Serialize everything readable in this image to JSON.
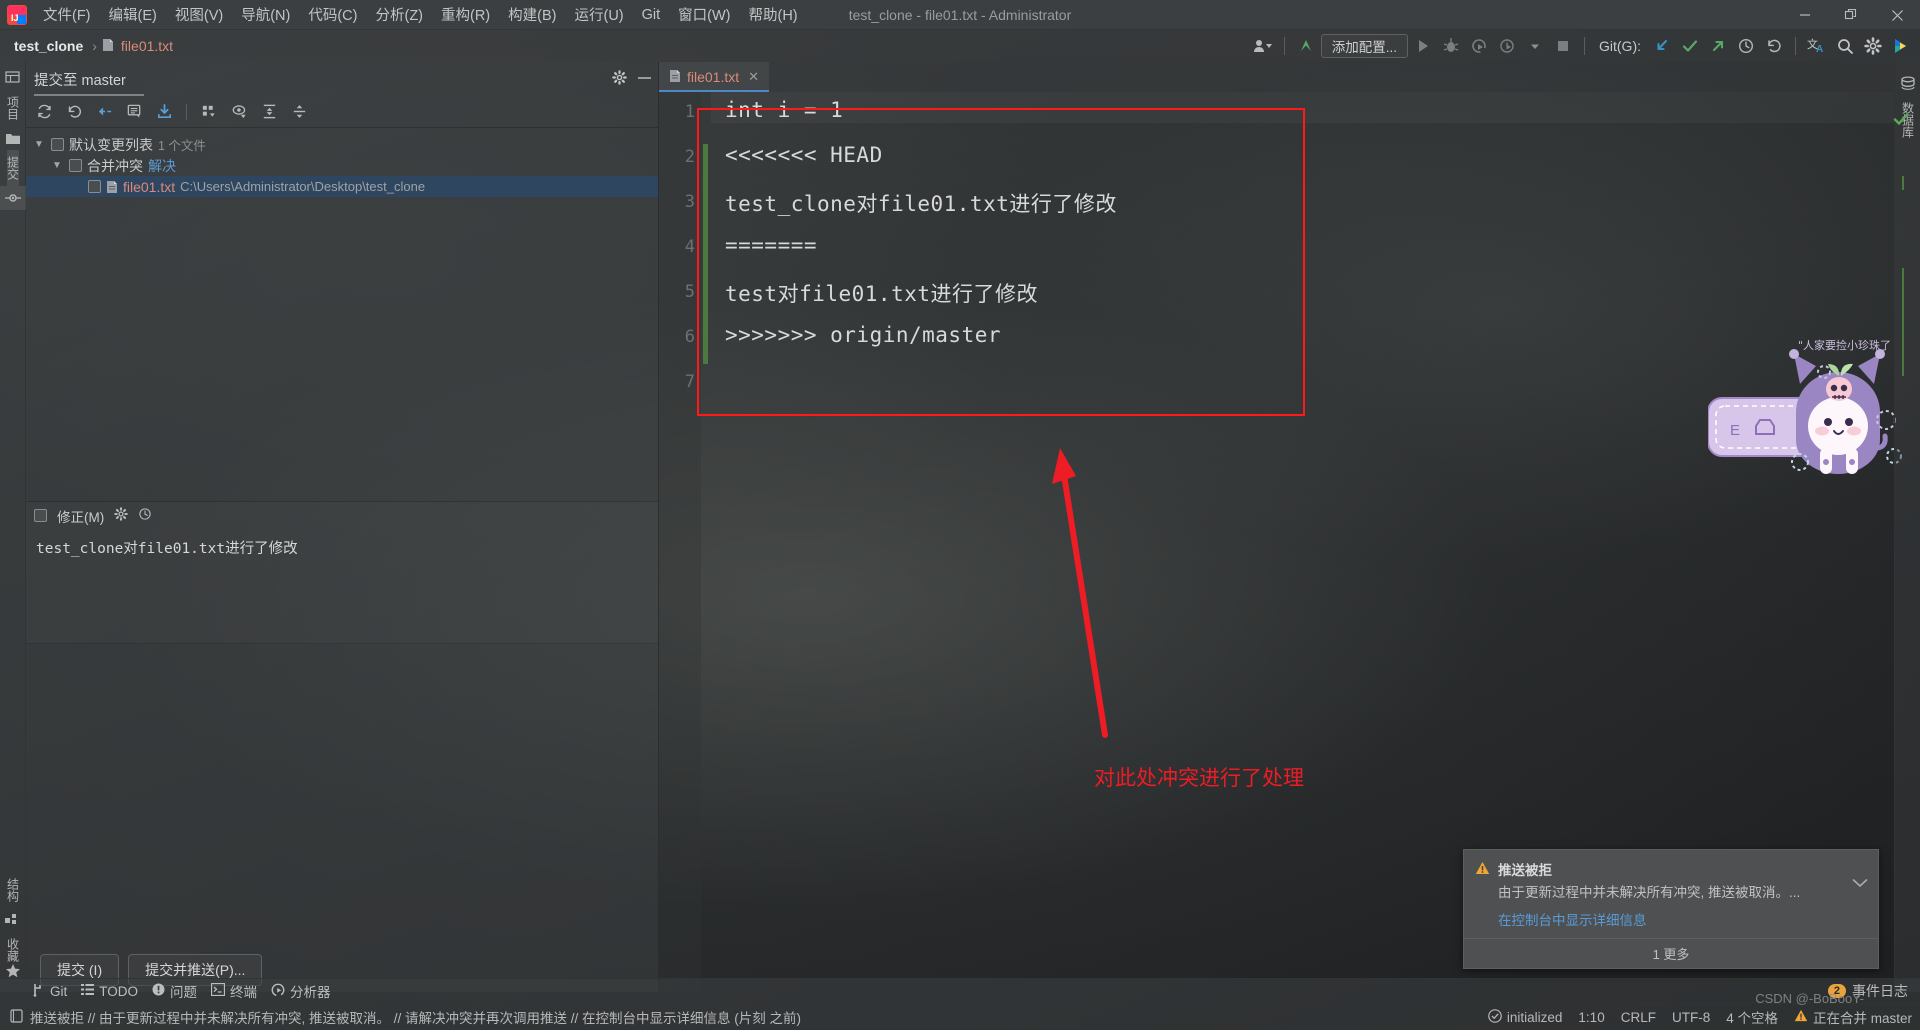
{
  "window": {
    "title": "test_clone - file01.txt - Administrator",
    "minimize": "—",
    "restore": "❐",
    "close": "✕"
  },
  "menu": {
    "items": [
      {
        "label": "文件(F)"
      },
      {
        "label": "编辑(E)"
      },
      {
        "label": "视图(V)"
      },
      {
        "label": "导航(N)"
      },
      {
        "label": "代码(C)"
      },
      {
        "label": "分析(Z)"
      },
      {
        "label": "重构(R)"
      },
      {
        "label": "构建(B)"
      },
      {
        "label": "运行(U)"
      },
      {
        "label": "Git"
      },
      {
        "label": "窗口(W)"
      },
      {
        "label": "帮助(H)"
      }
    ]
  },
  "navbar": {
    "breadcrumb": [
      {
        "label": "test_clone",
        "type": "project"
      },
      {
        "label": "file01.txt",
        "type": "file"
      }
    ],
    "separator": "›",
    "run_config_label": "添加配置...",
    "git_label": "Git(G):",
    "icons": {
      "user": "user-dropdown-icon",
      "update": "update-project-icon",
      "run": "run-icon",
      "debug": "debug-icon",
      "run_coverage": "run-with-coverage-icon",
      "profile": "profile-icon",
      "dropdown": "chevron-down-icon",
      "stop": "stop-icon",
      "git_pull": "git-update-icon",
      "git_commit": "git-commit-icon",
      "git_push": "git-push-icon",
      "git_history": "git-history-icon",
      "git_rollback": "git-rollback-icon",
      "translate": "translate-icon",
      "search": "search-everywhere-icon",
      "settings": "settings-icon",
      "ide_extra": "plugin-icon"
    }
  },
  "rails": {
    "left": [
      {
        "label": "项目",
        "name": "tool-window-project"
      },
      {
        "label": "",
        "name": "folder-icon"
      },
      {
        "label": "提交",
        "name": "tool-window-commit"
      },
      {
        "label": "",
        "name": "structure-icon"
      },
      {
        "label": "结构",
        "name": "tool-window-structure"
      },
      {
        "label": "收藏",
        "name": "tool-window-favorites"
      }
    ],
    "right": [
      {
        "label": "数据库",
        "name": "tool-window-database"
      }
    ]
  },
  "commit_panel": {
    "title": "提交至 master",
    "header_icons": {
      "settings": "gear-icon",
      "minimize": "minimize-icon"
    },
    "toolbar_icons": [
      {
        "name": "refresh-changes-icon"
      },
      {
        "name": "rollback-icon"
      },
      {
        "name": "shelve-icon"
      },
      {
        "name": "show-diff-icon"
      },
      {
        "name": "get-from-vcs-icon"
      },
      {
        "name": "group-by-icon"
      },
      {
        "name": "preview-icon"
      },
      {
        "name": "expand-all-icon"
      },
      {
        "name": "collapse-all-icon"
      }
    ],
    "tree": [
      {
        "label": "默认变更列表",
        "count_text": "1 个文件",
        "expanded": true,
        "indent": 0,
        "selected": false,
        "children": [
          {
            "label": "合并冲突",
            "link": "解决",
            "expanded": true,
            "indent": 1,
            "selected": false,
            "children": [
              {
                "file": "file01.txt",
                "path": "C:\\Users\\Administrator\\Desktop\\test_clone",
                "indent": 2,
                "selected": true
              }
            ]
          }
        ]
      }
    ],
    "amend_label": "修正(M)",
    "amend_icons": {
      "gear": "gear-icon",
      "history": "history-icon"
    },
    "commit_message": "test_clone对file01.txt进行了修改",
    "buttons": [
      {
        "label": "提交 (I)",
        "name": "commit-button"
      },
      {
        "label": "提交并推送(P)...",
        "name": "commit-and-push-button"
      }
    ]
  },
  "editor": {
    "tab": {
      "label": "file01.txt",
      "close": "✕"
    },
    "lines": [
      {
        "no": "1",
        "text": "int i = 1",
        "changed": false
      },
      {
        "no": "2",
        "text": "<<<<<<< HEAD",
        "changed": true
      },
      {
        "no": "3",
        "text": "test_clone对file01.txt进行了修改",
        "changed": true
      },
      {
        "no": "4",
        "text": "=======",
        "changed": true
      },
      {
        "no": "5",
        "text": "test对file01.txt进行了修改",
        "changed": true
      },
      {
        "no": "6",
        "text": ">>>>>>> origin/master",
        "changed": true
      },
      {
        "no": "7",
        "text": "",
        "changed": false
      }
    ],
    "inspection_status": "no-problems-check-icon"
  },
  "annotation": {
    "text": "对此处冲突进行了处理",
    "color": "#ee1c24",
    "box_color": "#ff1a1a",
    "arrow": "red-arrow-up"
  },
  "sticker": {
    "caption": "\"人家要捡小珍珠了",
    "name": "kuromi-wallpaper-sticker"
  },
  "notification": {
    "icon": "warning-triangle-icon",
    "title": "推送被拒",
    "description": "由于更新过程中并未解决所有冲突, 推送被取消。...",
    "link": "在控制台中显示详细信息",
    "more": "1 更多",
    "collapse": "chevron-down-icon"
  },
  "bottom_bar": {
    "items": [
      {
        "label": "Git",
        "icon": "git-branch-icon"
      },
      {
        "label": "TODO",
        "icon": "todo-list-icon"
      },
      {
        "label": "问题",
        "icon": "problems-icon"
      },
      {
        "label": "终端",
        "icon": "terminal-icon"
      },
      {
        "label": "分析器",
        "icon": "profiler-icon"
      }
    ],
    "event_log": {
      "label": "事件日志",
      "badge": "2"
    }
  },
  "status_bar": {
    "left_icon": "memory-indicator-icon",
    "message": "推送被拒 // 由于更新过程中并未解决所有冲突, 推送被取消。 // 请解决冲突并再次调用推送 // 在控制台中显示详细信息 (片刻 之前)",
    "right": [
      {
        "label": "initialized",
        "icon": "check-circle-icon"
      },
      {
        "label": "1:10"
      },
      {
        "label": "CRLF"
      },
      {
        "label": "UTF-8"
      },
      {
        "label": "4 个空格"
      },
      {
        "label": "正在合并 master",
        "icon": "warning-triangle-icon"
      }
    ]
  },
  "watermark": "CSDN @-BoBooY-"
}
